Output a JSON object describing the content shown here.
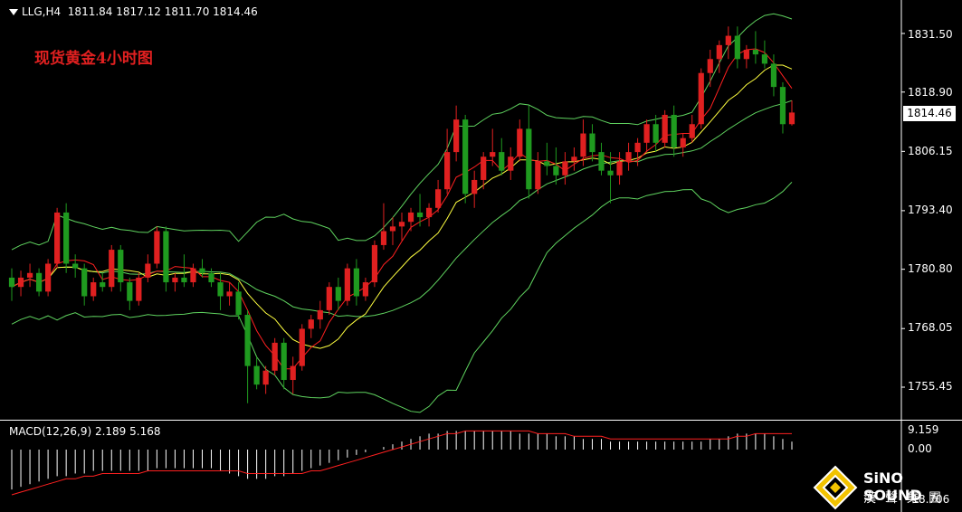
{
  "header": {
    "symbol": "LLG,H4",
    "open": "1811.84",
    "high": "1817.12",
    "low": "1811.70",
    "close": "1814.46",
    "subtitle": "现货黄金4小时图"
  },
  "price_axis": {
    "ticks": [
      "1831.50",
      "1818.90",
      "1806.15",
      "1793.40",
      "1780.80",
      "1768.05",
      "1755.45"
    ],
    "last_price": "1814.46"
  },
  "macd": {
    "label": "MACD(12,26,9) 2.189 5.168",
    "ticks": [
      "9.159",
      "0.00",
      "-18.706"
    ]
  },
  "logo": {
    "brand": "SiNO SOUND",
    "brand_cn": "漢聲集團"
  },
  "colors": {
    "background": "#000000",
    "up_candle": "#e02020",
    "down_candle": "#1f9a1f",
    "bollinger": "#5fd35f",
    "ma_fast": "#ff2020",
    "ma_slow": "#ffff40",
    "macd_histogram": "#ffffff",
    "macd_signal": "#ff2020"
  },
  "chart_data": [
    {
      "type": "candlestick",
      "title": "现货黄金4小时图",
      "ylim": [
        1748,
        1838
      ],
      "candles": [
        [
          1779.0,
          1781.0,
          1774.0,
          1777.0
        ],
        [
          1777.0,
          1780.5,
          1775.0,
          1779.0
        ],
        [
          1779.0,
          1782.0,
          1777.0,
          1780.0
        ],
        [
          1780.0,
          1781.0,
          1775.0,
          1776.0
        ],
        [
          1776.0,
          1783.0,
          1775.0,
          1782.0
        ],
        [
          1782.0,
          1794.0,
          1781.0,
          1793.0
        ],
        [
          1793.0,
          1795.0,
          1780.0,
          1782.0
        ],
        [
          1782.0,
          1784.0,
          1779.0,
          1781.0
        ],
        [
          1781.0,
          1782.0,
          1773.0,
          1775.0
        ],
        [
          1775.0,
          1779.0,
          1774.0,
          1778.0
        ],
        [
          1778.0,
          1780.0,
          1776.0,
          1777.0
        ],
        [
          1777.0,
          1786.0,
          1776.0,
          1785.0
        ],
        [
          1785.0,
          1786.0,
          1776.0,
          1778.0
        ],
        [
          1778.0,
          1779.0,
          1772.0,
          1774.0
        ],
        [
          1774.0,
          1780.0,
          1773.0,
          1779.0
        ],
        [
          1779.0,
          1784.0,
          1778.0,
          1782.0
        ],
        [
          1782.0,
          1790.0,
          1781.0,
          1789.0
        ],
        [
          1789.0,
          1790.0,
          1776.0,
          1778.0
        ],
        [
          1778.0,
          1780.0,
          1776.0,
          1779.0
        ],
        [
          1779.0,
          1784.0,
          1777.0,
          1778.0
        ],
        [
          1778.0,
          1782.0,
          1777.0,
          1781.0
        ],
        [
          1781.0,
          1783.0,
          1779.0,
          1780.0
        ],
        [
          1780.0,
          1781.0,
          1777.0,
          1778.0
        ],
        [
          1778.0,
          1780.0,
          1772.0,
          1775.0
        ],
        [
          1775.0,
          1778.0,
          1773.0,
          1776.0
        ],
        [
          1776.0,
          1778.0,
          1770.0,
          1771.0
        ],
        [
          1771.0,
          1772.0,
          1752.0,
          1760.0
        ],
        [
          1760.0,
          1762.0,
          1755.0,
          1756.0
        ],
        [
          1756.0,
          1760.0,
          1754.0,
          1759.0
        ],
        [
          1759.0,
          1766.0,
          1758.0,
          1765.0
        ],
        [
          1765.0,
          1766.0,
          1755.0,
          1757.0
        ],
        [
          1757.0,
          1762.0,
          1754.0,
          1760.0
        ],
        [
          1760.0,
          1769.0,
          1759.0,
          1768.0
        ],
        [
          1768.0,
          1771.0,
          1766.0,
          1770.0
        ],
        [
          1770.0,
          1774.0,
          1768.0,
          1772.0
        ],
        [
          1772.0,
          1778.0,
          1771.0,
          1777.0
        ],
        [
          1777.0,
          1779.0,
          1772.0,
          1774.0
        ],
        [
          1774.0,
          1782.0,
          1773.0,
          1781.0
        ],
        [
          1781.0,
          1783.0,
          1773.0,
          1775.0
        ],
        [
          1775.0,
          1779.0,
          1774.0,
          1778.0
        ],
        [
          1778.0,
          1787.0,
          1777.0,
          1786.0
        ],
        [
          1786.0,
          1795.0,
          1785.0,
          1789.0
        ],
        [
          1789.0,
          1792.0,
          1786.0,
          1790.0
        ],
        [
          1790.0,
          1793.0,
          1787.0,
          1791.0
        ],
        [
          1791.0,
          1794.0,
          1789.0,
          1793.0
        ],
        [
          1793.0,
          1797.0,
          1790.0,
          1792.0
        ],
        [
          1792.0,
          1795.0,
          1790.0,
          1794.0
        ],
        [
          1794.0,
          1800.0,
          1793.0,
          1798.0
        ],
        [
          1798.0,
          1811.0,
          1797.0,
          1806.0
        ],
        [
          1806.0,
          1816.0,
          1804.0,
          1813.0
        ],
        [
          1813.0,
          1814.0,
          1795.0,
          1797.0
        ],
        [
          1797.0,
          1802.0,
          1794.0,
          1800.0
        ],
        [
          1800.0,
          1806.0,
          1798.0,
          1805.0
        ],
        [
          1805.0,
          1811.0,
          1803.0,
          1806.0
        ],
        [
          1806.0,
          1809.0,
          1801.0,
          1802.0
        ],
        [
          1802.0,
          1807.0,
          1800.0,
          1805.0
        ],
        [
          1805.0,
          1813.0,
          1804.0,
          1811.0
        ],
        [
          1811.0,
          1816.0,
          1796.0,
          1798.0
        ],
        [
          1798.0,
          1806.0,
          1797.0,
          1804.0
        ],
        [
          1804.0,
          1808.0,
          1801.0,
          1803.0
        ],
        [
          1803.0,
          1807.0,
          1799.0,
          1801.0
        ],
        [
          1801.0,
          1806.0,
          1799.0,
          1804.0
        ],
        [
          1804.0,
          1807.0,
          1802.0,
          1805.0
        ],
        [
          1805.0,
          1813.0,
          1803.0,
          1810.0
        ],
        [
          1810.0,
          1812.0,
          1804.0,
          1806.0
        ],
        [
          1806.0,
          1808.0,
          1801.0,
          1802.0
        ],
        [
          1802.0,
          1806.0,
          1795.0,
          1801.0
        ],
        [
          1801.0,
          1806.0,
          1799.0,
          1804.0
        ],
        [
          1804.0,
          1808.0,
          1802.0,
          1806.0
        ],
        [
          1806.0,
          1809.0,
          1803.0,
          1808.0
        ],
        [
          1808.0,
          1813.0,
          1806.0,
          1812.0
        ],
        [
          1812.0,
          1814.0,
          1806.0,
          1808.0
        ],
        [
          1808.0,
          1815.0,
          1807.0,
          1814.0
        ],
        [
          1814.0,
          1816.0,
          1805.0,
          1807.0
        ],
        [
          1807.0,
          1810.0,
          1805.0,
          1809.0
        ],
        [
          1809.0,
          1814.0,
          1808.0,
          1812.0
        ],
        [
          1812.0,
          1824.0,
          1811.0,
          1823.0
        ],
        [
          1823.0,
          1828.0,
          1820.0,
          1826.0
        ],
        [
          1826.0,
          1830.0,
          1823.0,
          1829.0
        ],
        [
          1829.0,
          1833.0,
          1826.0,
          1831.0
        ],
        [
          1831.0,
          1833.0,
          1824.0,
          1826.0
        ],
        [
          1826.0,
          1829.0,
          1824.0,
          1828.0
        ],
        [
          1828.0,
          1832.0,
          1825.0,
          1827.0
        ],
        [
          1827.0,
          1830.0,
          1824.0,
          1825.0
        ],
        [
          1825.0,
          1827.0,
          1818.0,
          1820.0
        ],
        [
          1820.0,
          1821.0,
          1810.0,
          1812.0
        ],
        [
          1812.0,
          1817.1,
          1811.7,
          1814.5
        ]
      ]
    },
    {
      "type": "histogram",
      "title": "MACD(12,26,9) 2.189 5.168",
      "ylim": [
        -18.706,
        9.159
      ],
      "values": [
        -15,
        -14,
        -13,
        -12,
        -11,
        -10,
        -10,
        -9,
        -9,
        -8,
        -8,
        -8,
        -8,
        -8,
        -8,
        -8,
        -7,
        -7,
        -7,
        -7,
        -7,
        -7,
        -7,
        -8,
        -9,
        -10,
        -11,
        -11,
        -11,
        -10,
        -10,
        -9,
        -8,
        -7,
        -6,
        -5,
        -4,
        -3,
        -2,
        -1,
        0,
        1,
        2,
        3,
        4,
        5,
        6,
        6,
        7,
        7,
        7,
        7,
        7,
        7,
        7,
        7,
        6,
        6,
        6,
        6,
        5,
        5,
        5,
        4,
        4,
        4,
        3,
        3,
        3,
        3,
        3,
        3,
        3,
        3,
        3,
        3,
        3,
        4,
        4,
        5,
        6,
        6,
        6,
        6,
        5,
        4,
        3
      ],
      "signal": [
        -17,
        -16,
        -15,
        -14,
        -13,
        -12,
        -11,
        -11,
        -10,
        -10,
        -9,
        -9,
        -9,
        -9,
        -9,
        -8,
        -8,
        -8,
        -8,
        -8,
        -8,
        -8,
        -8,
        -8,
        -8,
        -8,
        -9,
        -9,
        -9,
        -9,
        -9,
        -9,
        -9,
        -8,
        -8,
        -7,
        -6,
        -5,
        -4,
        -3,
        -2,
        -1,
        0,
        1,
        2,
        3,
        4,
        5,
        6,
        6,
        7,
        7,
        7,
        7,
        7,
        7,
        7,
        7,
        6,
        6,
        6,
        6,
        5,
        5,
        5,
        5,
        4,
        4,
        4,
        4,
        4,
        4,
        4,
        4,
        4,
        4,
        4,
        4,
        4,
        4,
        5,
        5,
        6,
        6,
        6,
        6,
        6
      ]
    }
  ]
}
